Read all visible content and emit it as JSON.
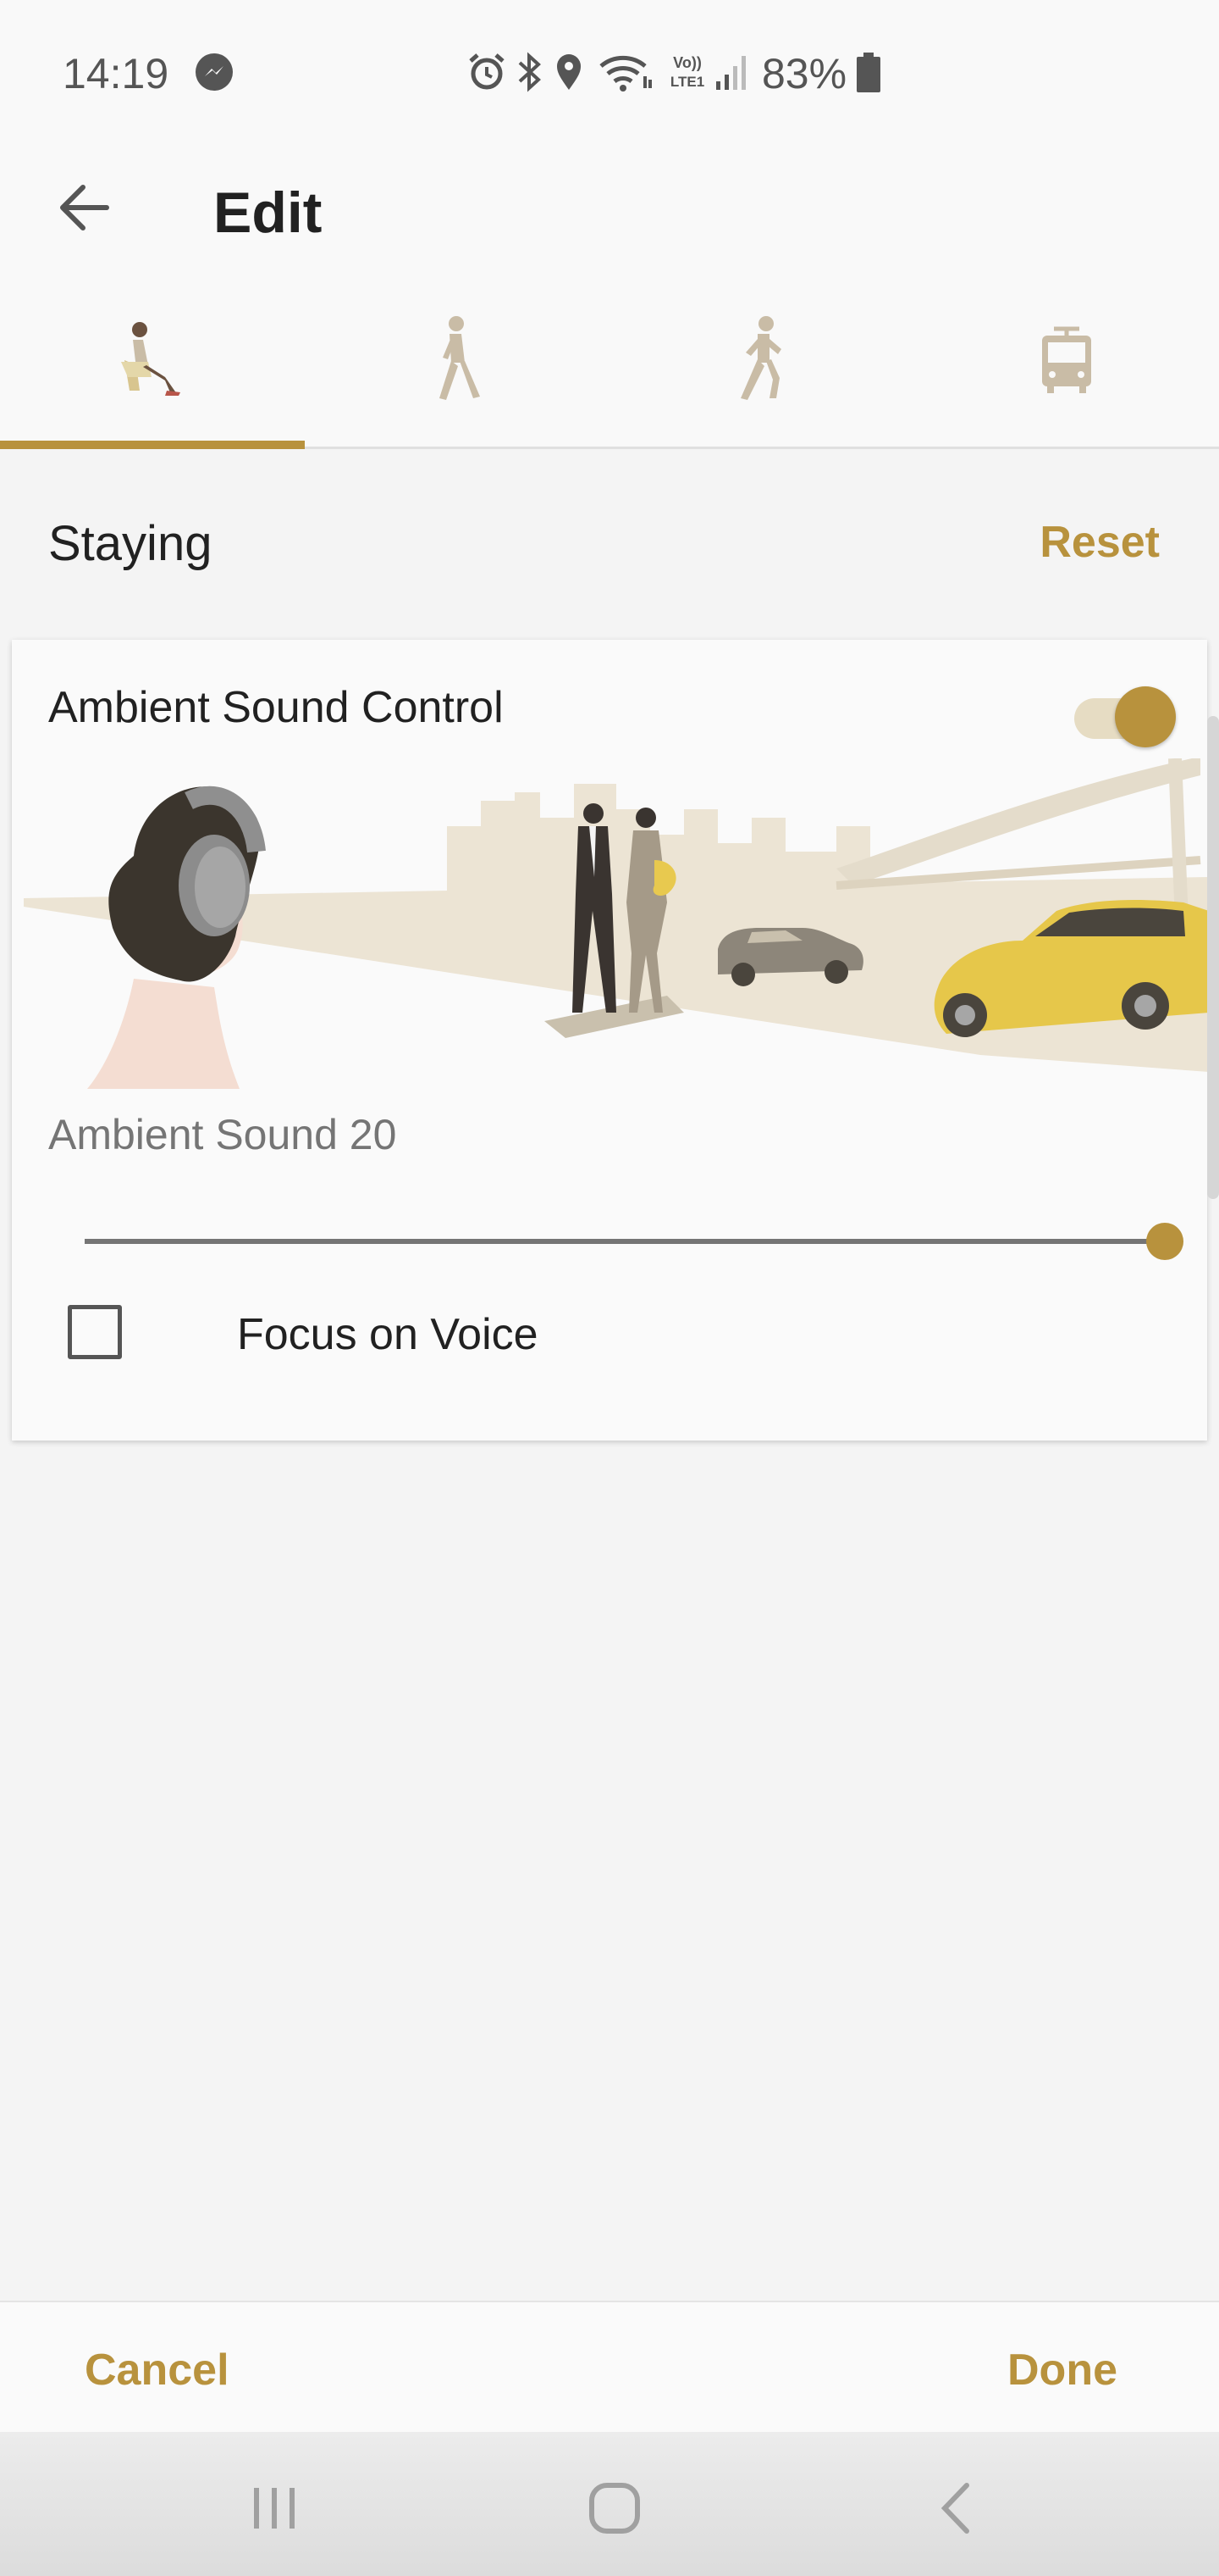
{
  "status_bar": {
    "time": "14:19",
    "battery": "83%",
    "icons": [
      "messenger-icon",
      "alarm-icon",
      "bluetooth-icon",
      "location-icon",
      "wifi-icon",
      "volte-icon",
      "signal-icon",
      "battery-icon"
    ],
    "volte_label": "VoLTE1"
  },
  "app_bar": {
    "title": "Edit"
  },
  "tabs": [
    {
      "name": "staying",
      "icon": "sitting-person-icon",
      "selected": true
    },
    {
      "name": "walking",
      "icon": "walking-person-icon",
      "selected": false
    },
    {
      "name": "running",
      "icon": "running-person-icon",
      "selected": false
    },
    {
      "name": "transport",
      "icon": "bus-icon",
      "selected": false
    }
  ],
  "section": {
    "title": "Staying",
    "reset_label": "Reset"
  },
  "card": {
    "title": "Ambient Sound Control",
    "toggle_on": true,
    "sound_label": "Ambient Sound 20",
    "slider_value": 20,
    "slider_max": 20,
    "focus_label": "Focus on Voice",
    "focus_checked": false
  },
  "bottom": {
    "cancel_label": "Cancel",
    "done_label": "Done"
  },
  "colors": {
    "accent": "#b8923d",
    "background": "#f4f4f4"
  }
}
